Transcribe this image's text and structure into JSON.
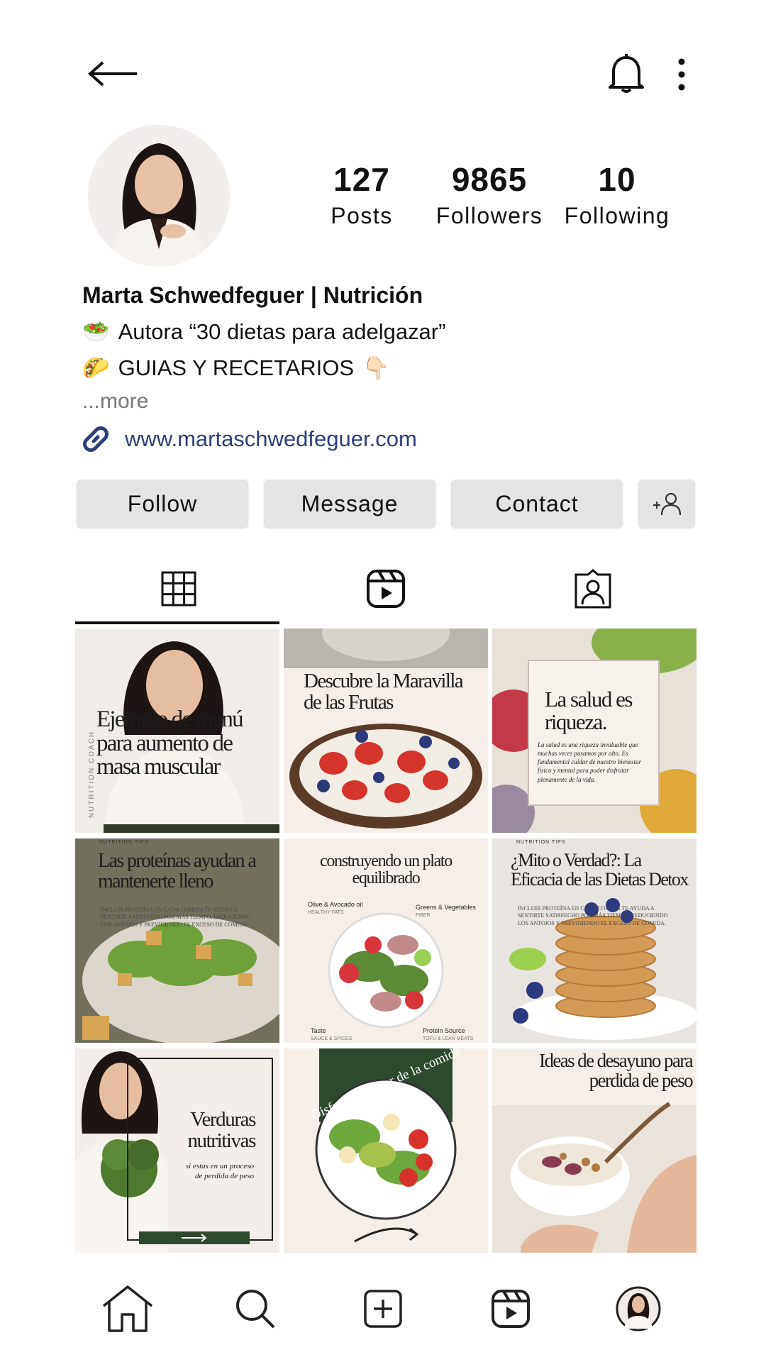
{
  "header": {
    "back_icon": "back-arrow-icon",
    "bell_icon": "bell-icon",
    "more_icon": "more-vertical-icon"
  },
  "profile": {
    "stats": [
      {
        "num": "127",
        "label": "Posts"
      },
      {
        "num": "9865",
        "label": "Followers"
      },
      {
        "num": "10",
        "label": "Following"
      }
    ],
    "name": "Marta Schwedfeguer | Nutrición",
    "bio_lines": [
      {
        "emoji": "🥗",
        "text": "Autora “30 dietas para adelgazar”"
      },
      {
        "emoji": "🌮",
        "text": "GUIAS Y RECETARIOS",
        "trail": "👇🏻"
      }
    ],
    "more": "...more",
    "url": "www.martaschwedfeguer.com"
  },
  "actions": {
    "follow": "Follow",
    "message": "Message",
    "contact": "Contact"
  },
  "posts": [
    {
      "text": "Ejemplo de menú para aumento de masa muscular",
      "side": "NUTRITION COACH"
    },
    {
      "text": "Descubre la Maravilla de las Frutas"
    },
    {
      "text": "La salud es riqueza.",
      "sub": "La salud es una riqueza invaluable que muchas veces pasamos por alto. Es fundamental cuidar de nuestro bienestar físico y mental para poder disfrutar plenamente de la vida."
    },
    {
      "kicker": "NUTRITION TIPS",
      "text": "Las proteínas ayudan a mantenerte lleno",
      "sub": "INCLUIR PROTEÍNA EN CADA COMIDA TE AYUDA A SENTIRTE SATISFECHO POR MÁS TIEMPO, REDUCIENDO LOS ANTOJOS Y PREVINIENDO EL EXCESO DE COMIDA."
    },
    {
      "text": "construyendo un plato equilibrado",
      "l1": "Olive & Avocado oil",
      "l1s": "HEALTHY FATS",
      "l2": "Greens & Vegetables",
      "l2s": "FIBER",
      "l3": "Taste",
      "l3s": "SAUCE & SPICES",
      "l4": "Protein Source",
      "l4s": "TOFU & LEAN MEATS"
    },
    {
      "kicker": "NUTRITION TIPS",
      "text": "¿Mito o Verdad?: La Eficacia de las Dietas Detox",
      "sub": "INCLUIR PROTEÍNA EN CADA COMIDA TE AYUDA A SENTIRTE SATISFECHO POR MÁS TIEMPO, REDUCIENDO LOS ANTOJOS Y PREVINIENDO EL EXCESO DE COMIDA."
    },
    {
      "text": "Verduras nutritivas",
      "sub": "si estas en un proceso de perdida de peso"
    },
    {
      "text": "Disfruta el sabor de la comida"
    },
    {
      "text": "Ideas de desayuno para perdida de peso"
    }
  ]
}
